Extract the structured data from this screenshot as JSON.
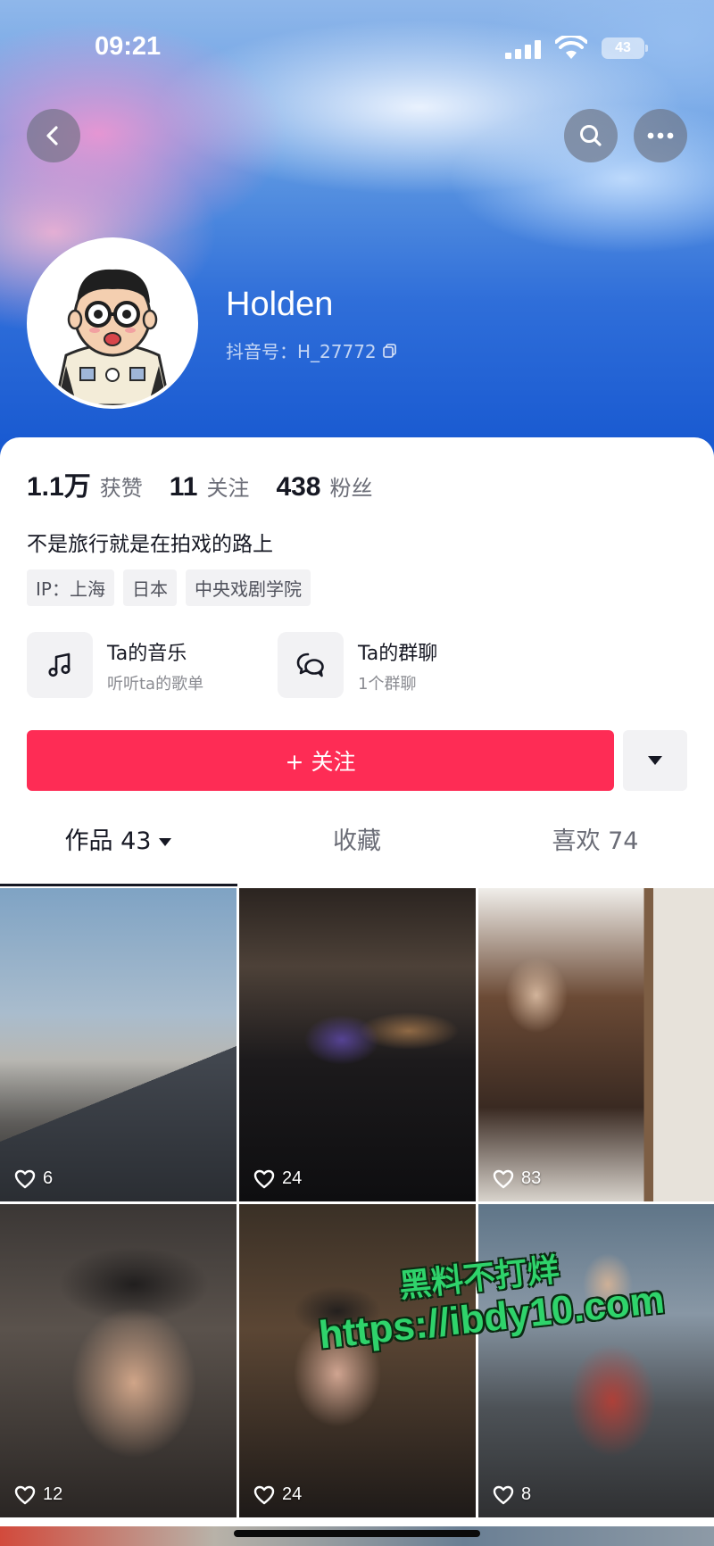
{
  "status_bar": {
    "time": "09:21",
    "battery": "43"
  },
  "profile": {
    "name": "Holden",
    "douyin_id": "抖音号：H_27772"
  },
  "stats": [
    {
      "value": "1.1万",
      "label": "获赞"
    },
    {
      "value": "11",
      "label": "关注"
    },
    {
      "value": "438",
      "label": "粉丝"
    }
  ],
  "bio": "不是旅行就是在拍戏的路上",
  "tags": [
    "IP：上海",
    "日本",
    "中央戏剧学院"
  ],
  "features": {
    "music": {
      "title": "Ta的音乐",
      "subtitle": "听听ta的歌单",
      "icon": "music-note-icon"
    },
    "group": {
      "title": "Ta的群聊",
      "subtitle": "1个群聊",
      "icon": "chat-bubbles-icon"
    }
  },
  "follow_button": "+ 关注",
  "tabs": {
    "works": "作品 43",
    "collect": "收藏",
    "likes": "喜欢 74"
  },
  "videos": [
    {
      "likes": "6"
    },
    {
      "likes": "24"
    },
    {
      "likes": "83"
    },
    {
      "likes": "12"
    },
    {
      "likes": "24"
    },
    {
      "likes": "8"
    }
  ],
  "watermark": {
    "line1": "黑料不打烊",
    "line2": "https://ibdy10.com"
  },
  "colors": {
    "accent": "#fe2c55",
    "text": "#161823",
    "secondary": "#6b6d77"
  }
}
